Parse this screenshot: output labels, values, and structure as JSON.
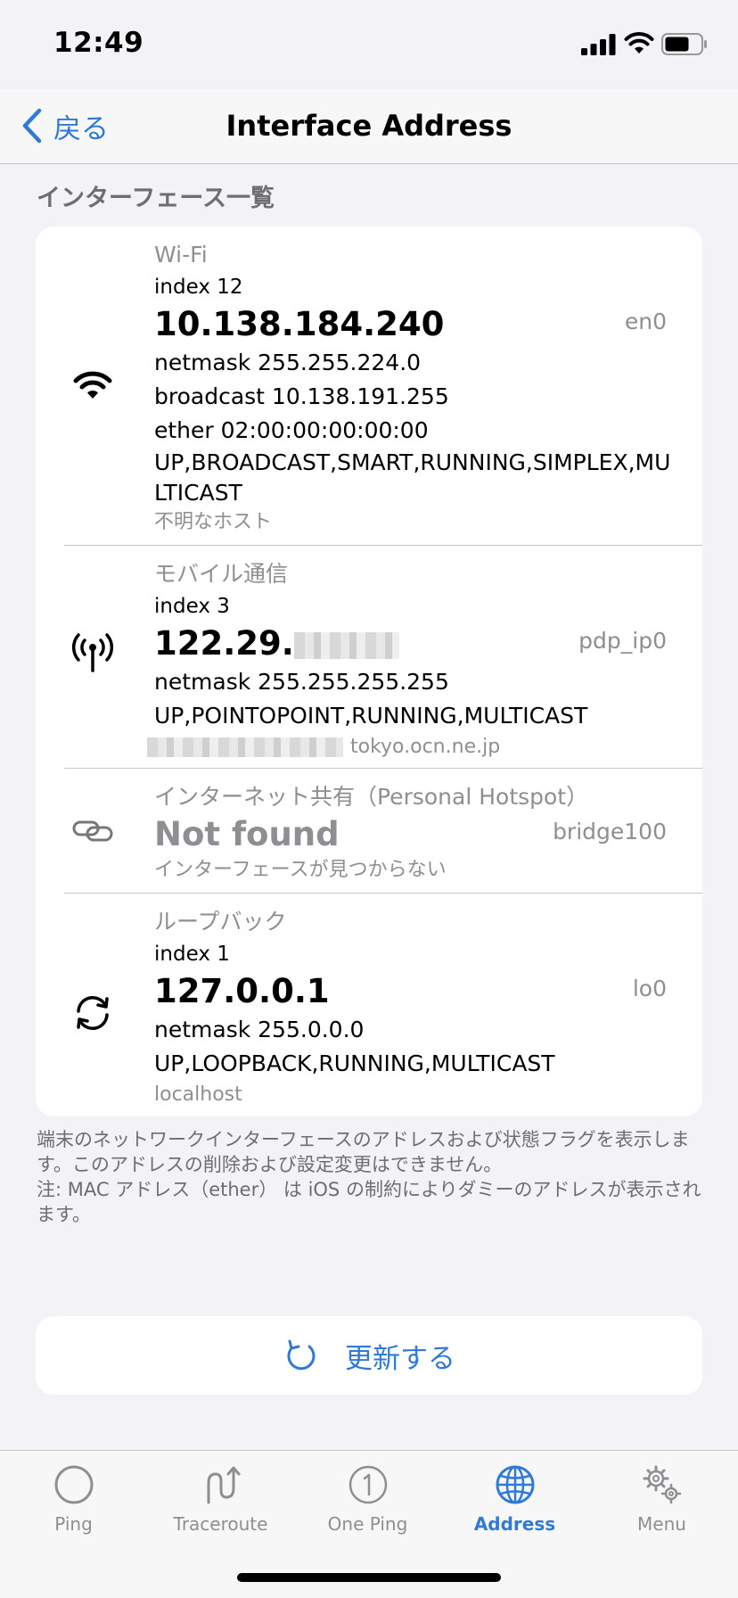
{
  "status_bar": {
    "time": "12:49"
  },
  "nav": {
    "back_label": "戻る",
    "title": "Interface Address"
  },
  "section_header": "インターフェース一覧",
  "interfaces": [
    {
      "label": "Wi-Fi",
      "index": "index 12",
      "address": "10.138.184.240",
      "iface": "en0",
      "netmask": "netmask 255.255.224.0",
      "broadcast": "broadcast 10.138.191.255",
      "ether": "ether 02:00:00:00:00:00",
      "flags": "UP,BROADCAST,SMART,RUNNING,SIMPLEX,MULTICAST",
      "host": "不明なホスト",
      "icon": "wifi-icon"
    },
    {
      "label": "モバイル通信",
      "index": "index 3",
      "address": "122.29.",
      "iface": "pdp_ip0",
      "netmask": "netmask 255.255.255.255",
      "flags": "UP,POINTOPOINT,RUNNING,MULTICAST",
      "host": "tokyo.ocn.ne.jp",
      "icon": "antenna-icon"
    },
    {
      "label": "インターネット共有（Personal Hotspot）",
      "address": "Not found",
      "iface": "bridge100",
      "host": "インターフェースが見つからない",
      "icon": "link-icon"
    },
    {
      "label": "ループバック",
      "index": "index 1",
      "address": "127.0.0.1",
      "iface": "lo0",
      "netmask": "netmask 255.0.0.0",
      "flags": "UP,LOOPBACK,RUNNING,MULTICAST",
      "host": "localhost",
      "icon": "loop-arrows-icon"
    }
  ],
  "footer_note": {
    "line1": "端末のネットワークインターフェースのアドレスおよび状態フラグを表示します。このアドレスの削除および設定変更はできません。",
    "line2": "注: MAC アドレス（ether） は iOS の制約によりダミーのアドレスが表示されます。"
  },
  "refresh_button": {
    "label": "更新する",
    "icon": "refresh-icon"
  },
  "tab_bar": {
    "active": "Address",
    "tabs": [
      {
        "label": "Ping",
        "icon": "circle-icon"
      },
      {
        "label": "Traceroute",
        "icon": "traceroute-icon"
      },
      {
        "label": "One Ping",
        "icon": "one-ping-icon"
      },
      {
        "label": "Address",
        "icon": "globe-icon"
      },
      {
        "label": "Menu",
        "icon": "gears-icon"
      }
    ]
  },
  "colors": {
    "accent": "#2f7ad9",
    "secondary_text": "#8e8e93",
    "background": "#f2f2f7"
  }
}
